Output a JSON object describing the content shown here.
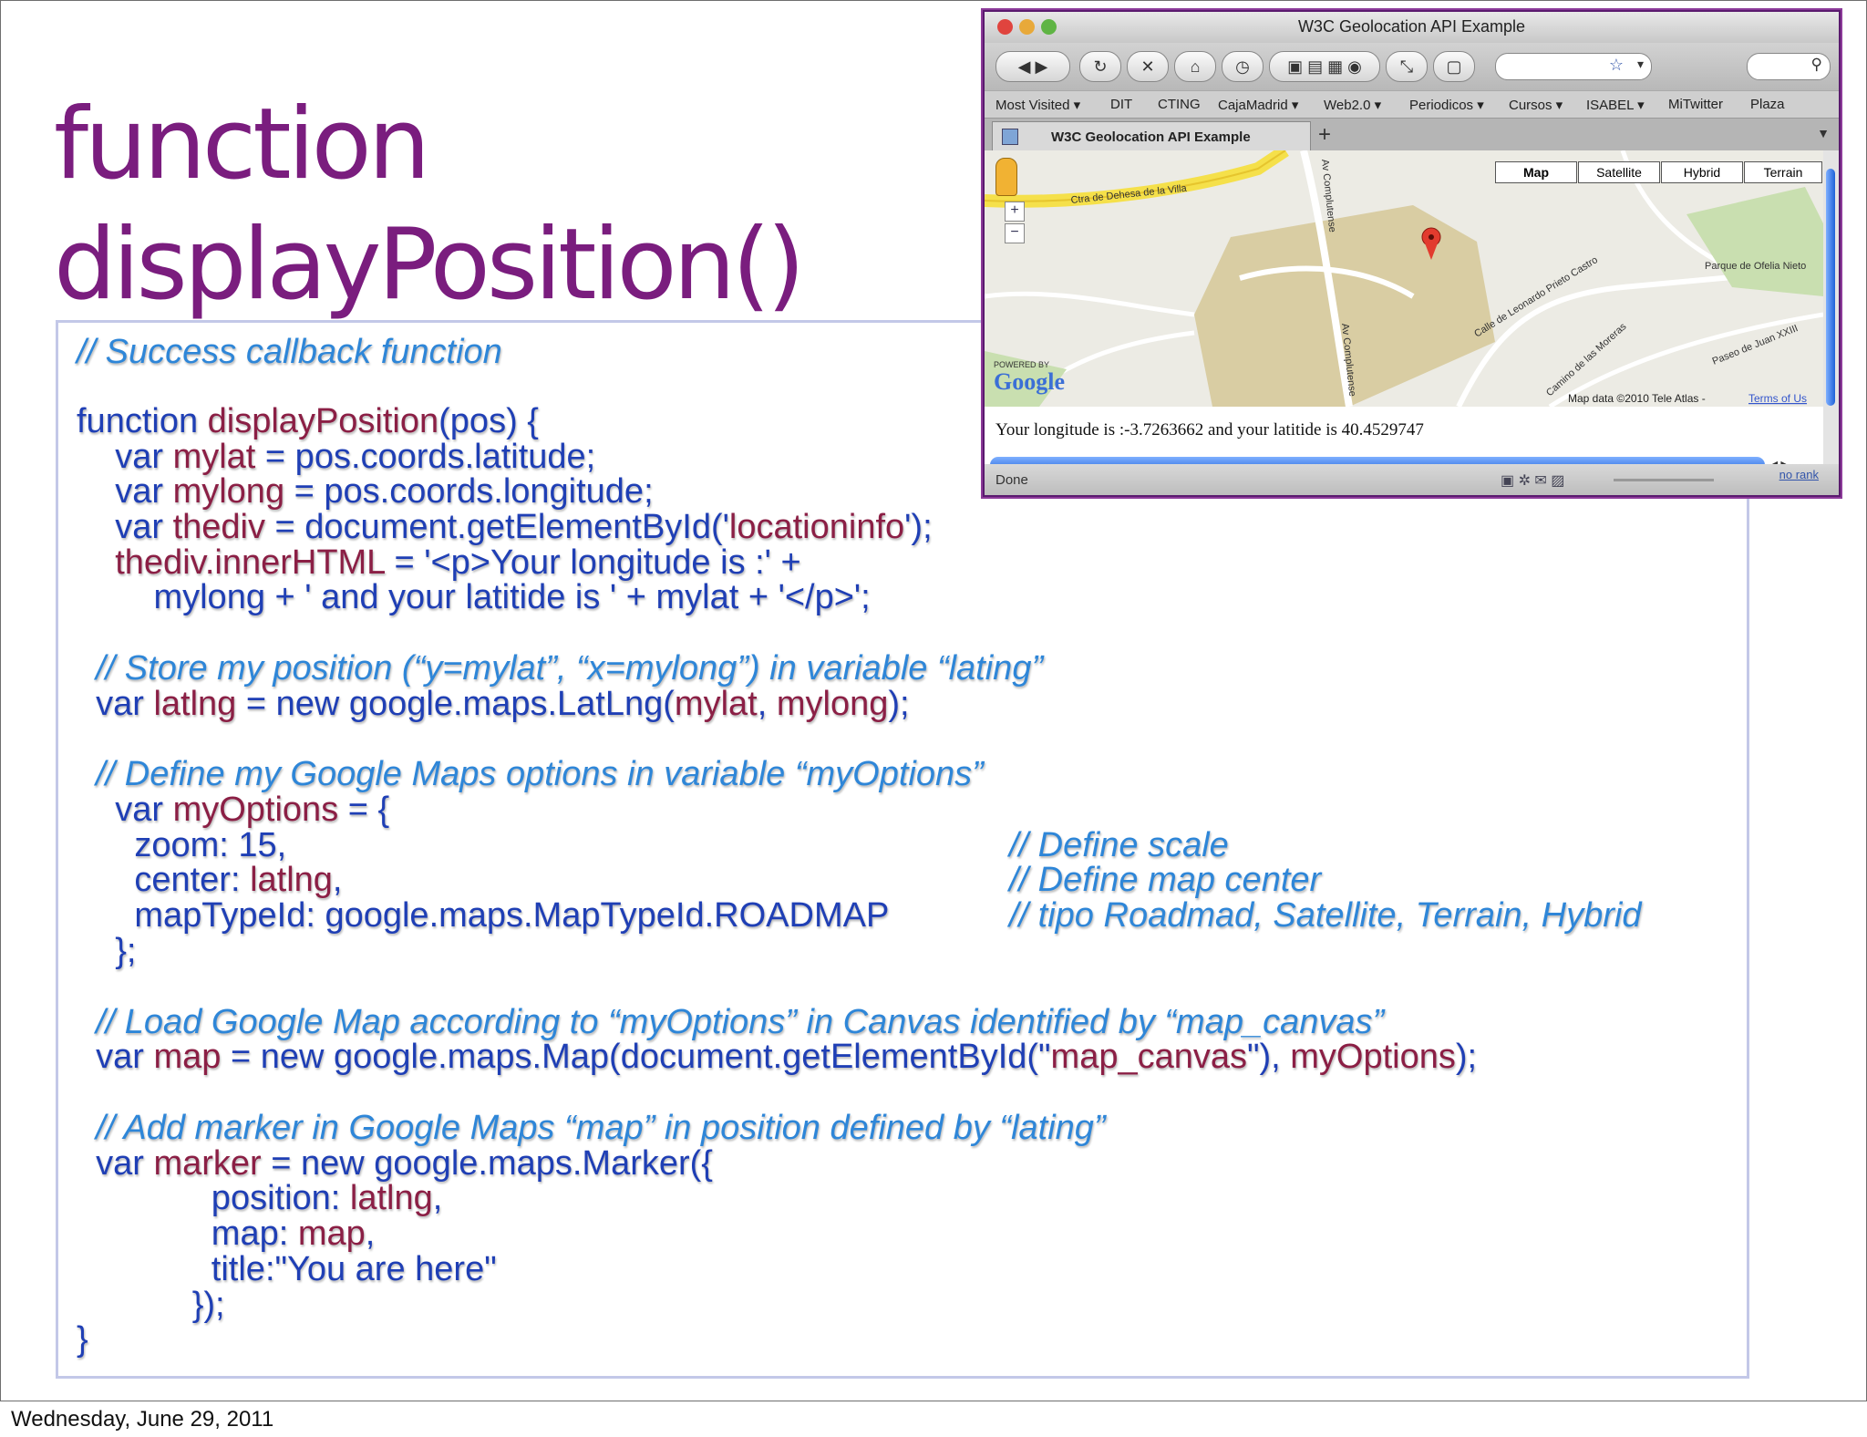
{
  "slide": {
    "title_line1": "function",
    "title_line2": "displayPosition()",
    "footer_date": "Wednesday, June 29, 2011"
  },
  "code": {
    "l1": "// Success callback function",
    "l2a": "function ",
    "l2b": "displayPosition",
    "l2c": "(pos) {",
    "l3a": "    var ",
    "l3b": "mylat",
    "l3c": " = pos.coords.latitude;",
    "l4a": "    var ",
    "l4b": "mylong",
    "l4c": " = pos.coords.longitude;",
    "l5a": "    var ",
    "l5b": "thediv",
    "l5c": " = document.getElementById('",
    "l5d": "locationinfo",
    "l5e": "');",
    "l6a": "    ",
    "l6b": "thediv.innerHTML",
    "l6c": " = '<p>Your longitude is :' +",
    "l7": "        mylong + ' and your latitide is ' + mylat + '</p>';",
    "l8": "  // Store my position (“y=mylat”, “x=mylong”) in variable “lating”",
    "l9a": "  var ",
    "l9b": "latlng",
    "l9c": " = new google.maps.LatLng(",
    "l9d": "mylat",
    "l9e": ", ",
    "l9f": "mylong",
    "l9g": ");",
    "l10": "  // Define my Google Maps options in variable “myOptions”",
    "l11a": "    var ",
    "l11b": "myOptions",
    "l11c": " = {",
    "l12a": "      zoom: 15,",
    "l12b": "// Define scale",
    "l13a": "      center: ",
    "l13b": "latlng",
    "l13c": ",",
    "l13d": "// Define map center",
    "l14a": "      mapTypeId: google.maps.MapTypeId.ROADMAP",
    "l14b": "// tipo Roadmad, Satellite, Terrain, Hybrid",
    "l15": "    };",
    "l16": "  // Load Google Map according to “myOptions” in Canvas identified by “map_canvas”",
    "l17a": "  var ",
    "l17b": "map",
    "l17c": " = new google.maps.Map(document.getElementById(\"",
    "l17d": "map_canvas",
    "l17e": "\"), ",
    "l17f": "myOptions",
    "l17g": ");",
    "l18": "  // Add marker in Google Maps “map” in position defined by “lating”",
    "l19a": "  var ",
    "l19b": "marker",
    "l19c": " = new google.maps.Marker({",
    "l20a": "              position: ",
    "l20b": "latlng",
    "l20c": ",",
    "l21a": "              map: ",
    "l21b": "map",
    "l21c": ",",
    "l22": "              title:\"You are here\"",
    "l23": "            });",
    "l24": "}"
  },
  "browser": {
    "window_title": "W3C Geolocation API Example",
    "tab_title": "W3C Geolocation API Example",
    "bookmarks": [
      "Most Visited ▾",
      "DIT",
      "CTING",
      "CajaMadrid ▾",
      "Web2.0 ▾",
      "Periodicos ▾",
      "Cursos ▾",
      "ISABEL ▾",
      "MiTwitter",
      "Plaza"
    ],
    "map_types": [
      "Map",
      "Satellite",
      "Hybrid",
      "Terrain"
    ],
    "map_labels": {
      "road1": "Ctra de Dehesa de la Villa",
      "road2": "Av Complutense",
      "road3": "Av Complutense",
      "road4": "Calle de Leonardo Prieto Castro",
      "road5": "Camino de las Moreras",
      "road6": "Paseo de Juan XXIII",
      "park": "Parque de Ofelia Nieto",
      "powered": "POWERED BY",
      "google": "Google",
      "mapdata": "Map data ©2010 Tele Atlas - ",
      "terms": "Terms of Us"
    },
    "info_text": "Your longitude is :-3.7263662 and your latitide is 40.4529747",
    "status_left": "Done",
    "status_right": "no rank"
  }
}
